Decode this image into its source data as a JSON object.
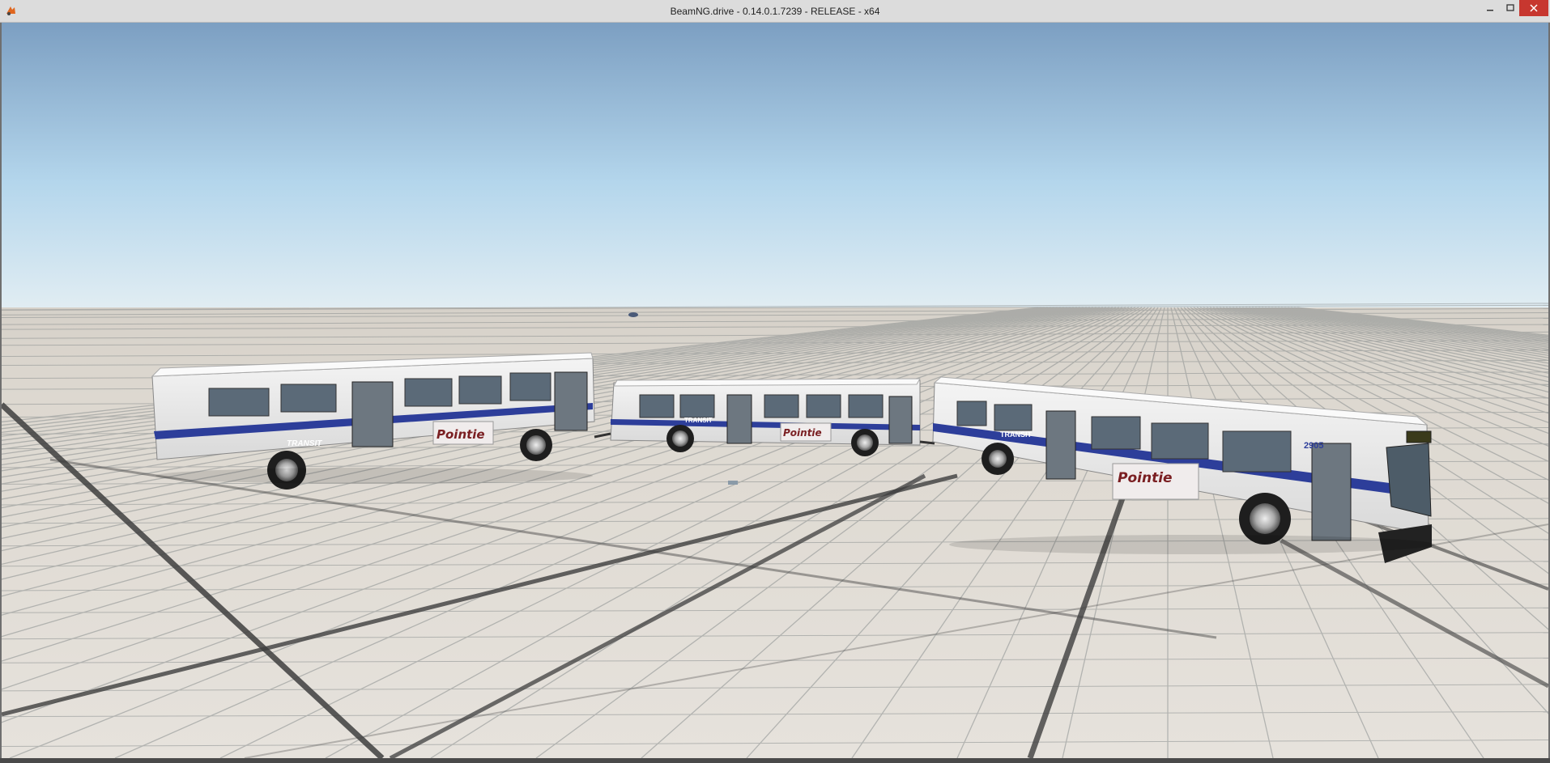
{
  "window": {
    "title": "BeamNG.drive - 0.14.0.1.7239 - RELEASE - x64",
    "icon": "beamng-app-icon",
    "controls": [
      "minimize-icon",
      "maximize-icon",
      "close-icon"
    ]
  },
  "scene": {
    "sky_top_color": "#7fa3c4",
    "sky_horizon_color": "#d9ecf7",
    "ground_color": "#dcd7cf",
    "grid_line_color": "#4b4b4b",
    "vehicles": [
      {
        "name": "bus-rear-trailer",
        "side_text": "TRANSIT",
        "ad_text": "Pointie"
      },
      {
        "name": "bus-middle-trailer",
        "side_text": "TRANSIT",
        "ad_text": "Pointie"
      },
      {
        "name": "bus-lead",
        "side_text": "TRANSIT",
        "ad_text": "Pointie",
        "fleet_number": "2905"
      }
    ]
  }
}
